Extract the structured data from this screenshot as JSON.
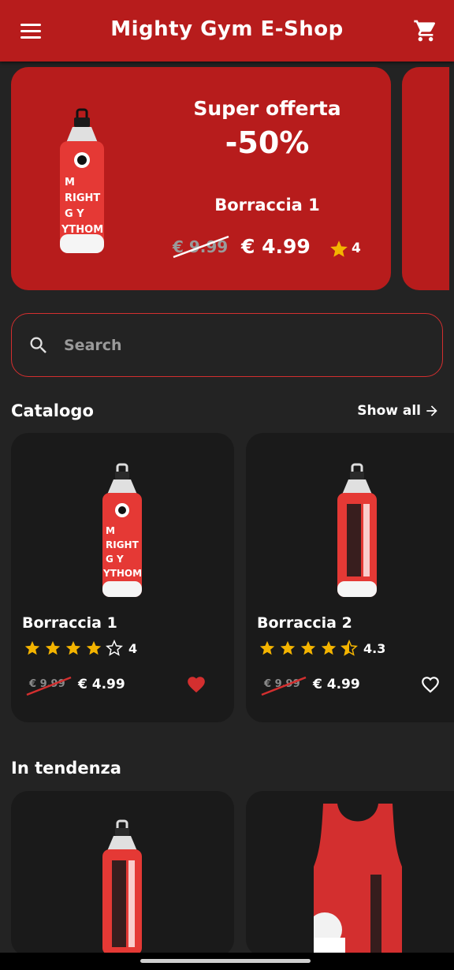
{
  "header": {
    "title": "Mighty Gym E-Shop",
    "menu_icon": "menu-icon",
    "cart_icon": "cart-icon"
  },
  "offer": {
    "label": "Super offerta",
    "discount": "-50%",
    "product_name": "Borraccia 1",
    "old_price": "€ 9.99",
    "price": "€ 4.99",
    "rating": "4",
    "bottle_text": [
      "M",
      "RIGHT",
      "G Y",
      "YTHOM"
    ]
  },
  "search": {
    "placeholder": "Search",
    "value": ""
  },
  "catalog": {
    "title": "Catalogo",
    "show_all": "Show all",
    "items": [
      {
        "name": "Borraccia 1",
        "rating_text": "4",
        "rating": 4,
        "old_price": "€ 9.99",
        "price": "€ 4.99",
        "favorite": true
      },
      {
        "name": "Borraccia 2",
        "rating_text": "4.3",
        "rating": 4.5,
        "old_price": "€ 9.99",
        "price": "€ 4.99",
        "favorite": false
      }
    ]
  },
  "trending": {
    "title": "In tendenza"
  },
  "colors": {
    "brand": "#b71c1c",
    "star": "#f4b400",
    "background": "#232323",
    "card": "#1a1a1a"
  }
}
